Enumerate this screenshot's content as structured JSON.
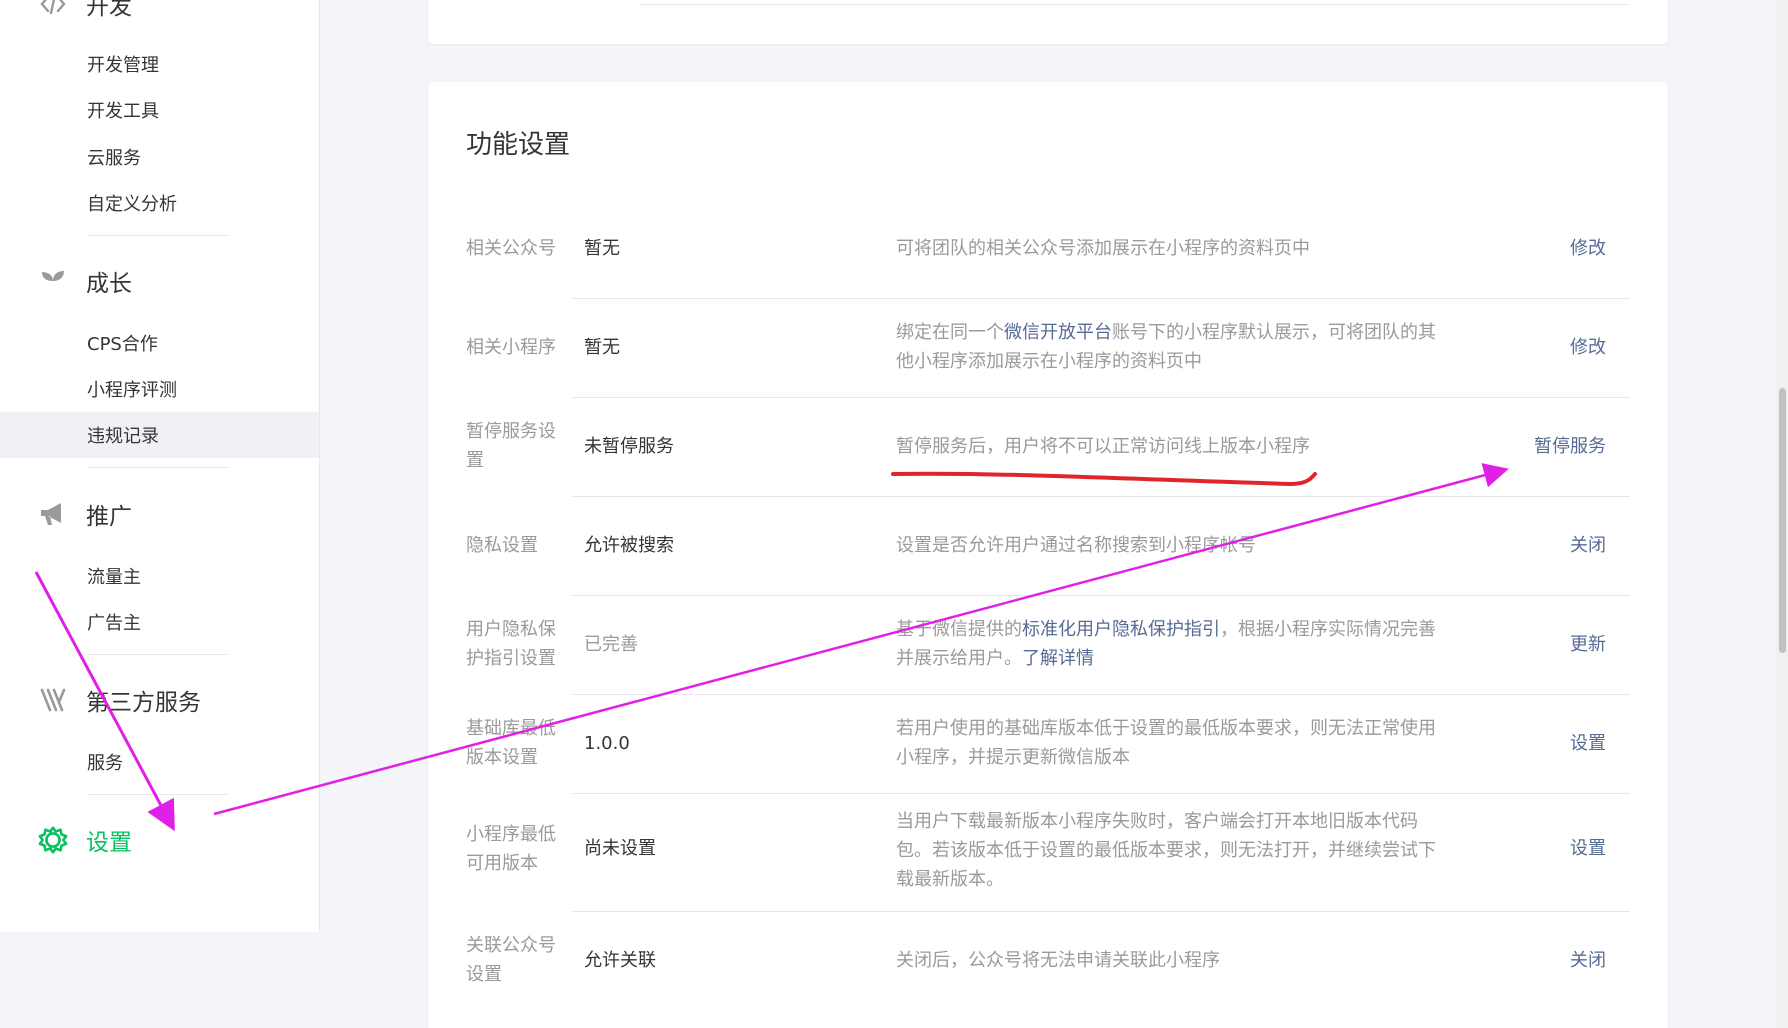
{
  "sidebar": {
    "groups": [
      {
        "name": "dev",
        "label": "开发",
        "icon": "code-icon"
      },
      {
        "name": "growth",
        "label": "成长",
        "icon": "sprout-icon"
      },
      {
        "name": "promotion",
        "label": "推广",
        "icon": "megaphone-icon"
      },
      {
        "name": "third-party",
        "label": "第三方服务",
        "icon": "third-party-icon"
      },
      {
        "name": "settings",
        "label": "设置",
        "icon": "gear-icon",
        "active": true
      }
    ],
    "dev_items": [
      "开发管理",
      "开发工具",
      "云服务",
      "自定义分析"
    ],
    "growth_items": [
      "CPS合作",
      "小程序评测",
      "违规记录"
    ],
    "promotion_items": [
      "流量主",
      "广告主"
    ],
    "third_party_items": [
      "服务"
    ],
    "selected_item": "违规记录"
  },
  "main": {
    "title": "功能设置",
    "rows": [
      {
        "label": "相关公众号",
        "value": "暂无",
        "desc": "可将团队的相关公众号添加展示在小程序的资料页中",
        "action": "修改"
      },
      {
        "label": "相关小程序",
        "value": "暂无",
        "desc_parts": [
          "绑定在同一个",
          "微信开放平台",
          "账号下的小程序默认展示，可将团队的其他小程序添加展示在小程序的资料页中"
        ],
        "action": "修改"
      },
      {
        "label": "暂停服务设置",
        "value": "未暂停服务",
        "desc": "暂停服务后，用户将不可以正常访问线上版本小程序",
        "action": "暂停服务"
      },
      {
        "label": "隐私设置",
        "value": "允许被搜索",
        "desc": "设置是否允许用户通过名称搜索到小程序帐号",
        "action": "关闭"
      },
      {
        "label": "用户隐私保护指引设置",
        "value": "已完善",
        "desc_parts": [
          "基于微信提供的",
          "标准化用户隐私保护指引",
          "，根据小程序实际情况完善并展示给用户。",
          "了解详情"
        ],
        "action": "更新"
      },
      {
        "label": "基础库最低版本设置",
        "value": "1.0.0",
        "desc": "若用户使用的基础库版本低于设置的最低版本要求，则无法正常使用小程序，并提示更新微信版本",
        "action": "设置"
      },
      {
        "label": "小程序最低可用版本",
        "value": "尚未设置",
        "desc": "当用户下载最新版本小程序失败时，客户端会打开本地旧版本代码包。若该版本低于设置的最低版本要求，则无法打开，并继续尝试下载最新版本。",
        "action": "设置"
      },
      {
        "label": "关联公众号设置",
        "value": "允许关联",
        "desc": "关闭后，公众号将无法申请关联此小程序",
        "action": "关闭"
      }
    ]
  },
  "colors": {
    "accent_green": "#07c160",
    "link_blue": "#576b95",
    "annotation_magenta": "#e020e6",
    "annotation_red": "#e0242c"
  }
}
